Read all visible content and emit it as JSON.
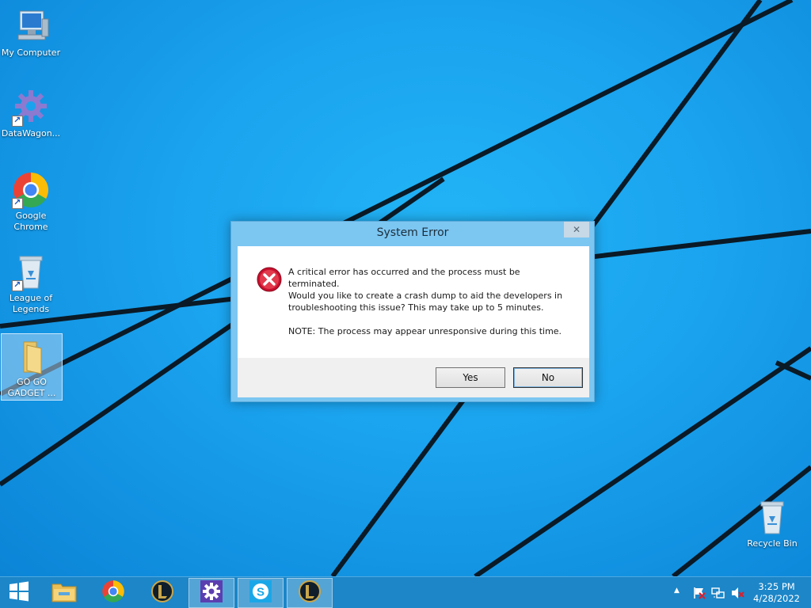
{
  "desktop": {
    "icons": [
      {
        "label": "My Computer"
      },
      {
        "label": "DataWagon..."
      },
      {
        "label_line1": "Google",
        "label_line2": "Chrome"
      },
      {
        "label_line1": "League of",
        "label_line2": "Legends"
      },
      {
        "label_line1": "GO GO",
        "label_line2": "GADGET ..."
      },
      {
        "label": "Recycle Bin"
      }
    ]
  },
  "dialog": {
    "title": "System Error",
    "close_glyph": "✕",
    "line1": "A critical error has occurred and the process must be terminated.",
    "line2a": "Would you like to create a crash dump to aid the developers in",
    "line2b": "troubleshooting this issue? This may take up to 5 minutes.",
    "line3": "NOTE: The process may appear unresponsive during this time.",
    "yes_label": "Yes",
    "no_label": "No",
    "icon": "error-icon"
  },
  "taskbar": {
    "start_icon": "windows-logo-icon",
    "pinned": [
      "file-explorer-icon",
      "chrome-icon",
      "league-of-legends-icon",
      "settings-icon",
      "skype-icon",
      "league-of-legends-icon"
    ],
    "tray_arrow": "▲",
    "time": "3:25 PM",
    "date": "4/28/2022"
  },
  "colors": {
    "accent": "#1c86c8",
    "desktop": "#1aa2ee",
    "error": "#c8102e"
  }
}
